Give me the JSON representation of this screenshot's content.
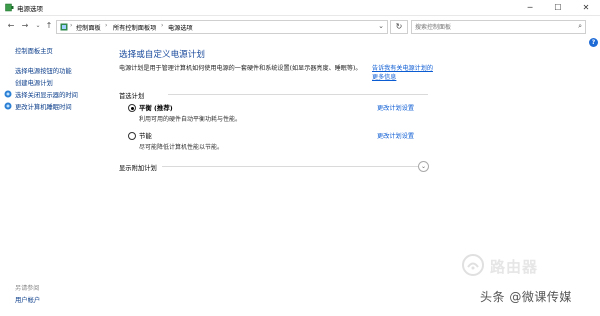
{
  "window": {
    "title": "电源选项",
    "minimize": "─",
    "maximize": "☐",
    "close": "✕"
  },
  "address": {
    "crumbs": [
      "控制面板",
      "所有控制面板项",
      "电源选项"
    ],
    "search_placeholder": "搜索控制面板"
  },
  "sidebar": {
    "items": [
      {
        "label": "控制面板主页"
      },
      {
        "label": "选择电源按钮的功能"
      },
      {
        "label": "创建电源计划"
      },
      {
        "label": "选择关闭显示器的时间"
      },
      {
        "label": "更改计算机睡眠时间"
      }
    ],
    "see_also_label": "另请参阅",
    "see_also_items": [
      {
        "label": "用户帐户"
      }
    ]
  },
  "main": {
    "heading": "选择或自定义电源计划",
    "description": "电源计划是用于管理计算机如何使用电源的一套硬件和系统设置(如显示器亮度、睡眠等)。",
    "description_link": "告诉我有关电源计划的更多信息",
    "preferred_label": "首选计划",
    "plans": [
      {
        "name": "平衡 (推荐)",
        "desc": "利用可用的硬件自动平衡功耗与性能。",
        "link": "更改计划设置",
        "selected": true
      },
      {
        "name": "节能",
        "desc": "尽可能降低计算机性能以节能。",
        "link": "更改计划设置",
        "selected": false
      }
    ],
    "more_plans_label": "显示附加计划"
  },
  "watermark": {
    "text1": "路由器",
    "text2": "头条 @微课传媒"
  },
  "colors": {
    "link": "#0b5bd3",
    "heading": "#1a4a9c",
    "help": "#1f6bd6"
  }
}
